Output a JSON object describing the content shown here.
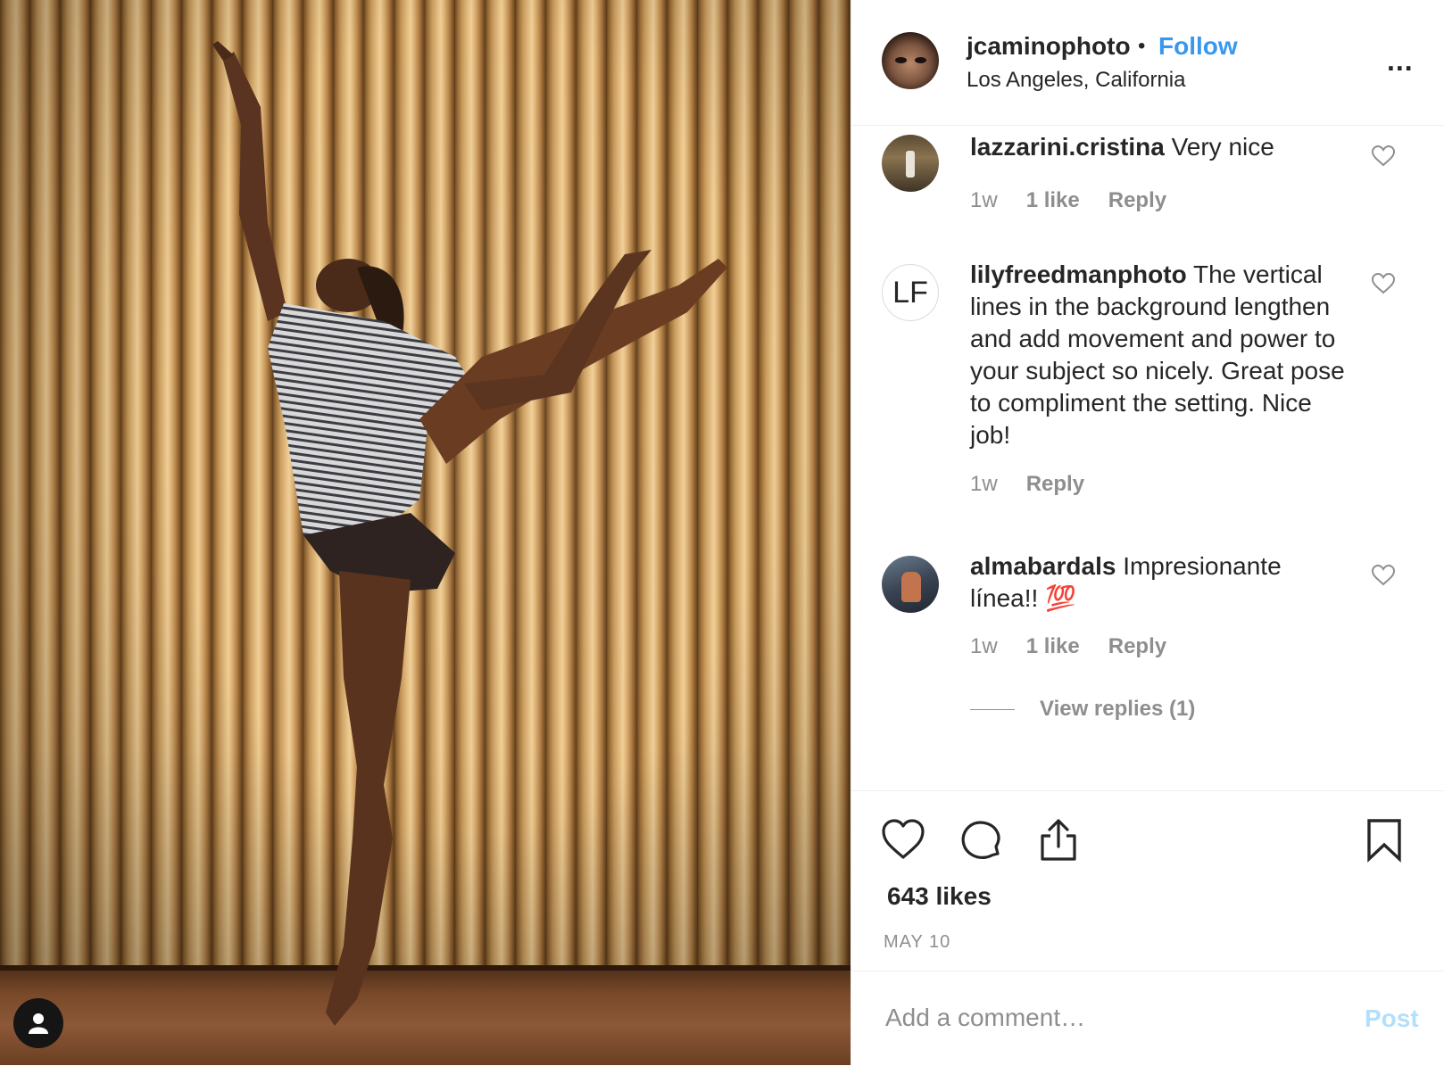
{
  "post": {
    "author": {
      "username": "jcaminophoto",
      "separator": "•",
      "follow_label": "Follow",
      "location": "Los Angeles, California",
      "more_label": "..."
    },
    "comments": [
      {
        "username": "lazzarini.cristina",
        "text": " Very nice",
        "time": "1w",
        "likes": "1 like",
        "reply": "Reply"
      },
      {
        "username": "lilyfreedmanphoto",
        "avatar_initials": "LF",
        "text": " The vertical lines in the background lengthen and add movement and power to your subject so nicely. Great pose to compliment the setting. Nice job!",
        "time": "1w",
        "reply": "Reply"
      },
      {
        "username": "almabardals",
        "text": " Impresionante línea!! 💯",
        "time": "1w",
        "likes": "1 like",
        "reply": "Reply"
      }
    ],
    "view_replies": "View replies (1)",
    "likes_count": "643 likes",
    "date": "MAY 10",
    "comment_box": {
      "placeholder": "Add a comment…",
      "post_label": "Post"
    }
  },
  "colors": {
    "link_blue": "#3897f0",
    "muted_text": "#8e8e8e",
    "post_disabled": "#b2dffc"
  },
  "icons": [
    "user-tag-icon",
    "heart-icon",
    "comment-icon",
    "share-icon",
    "bookmark-icon",
    "more-options-icon"
  ]
}
